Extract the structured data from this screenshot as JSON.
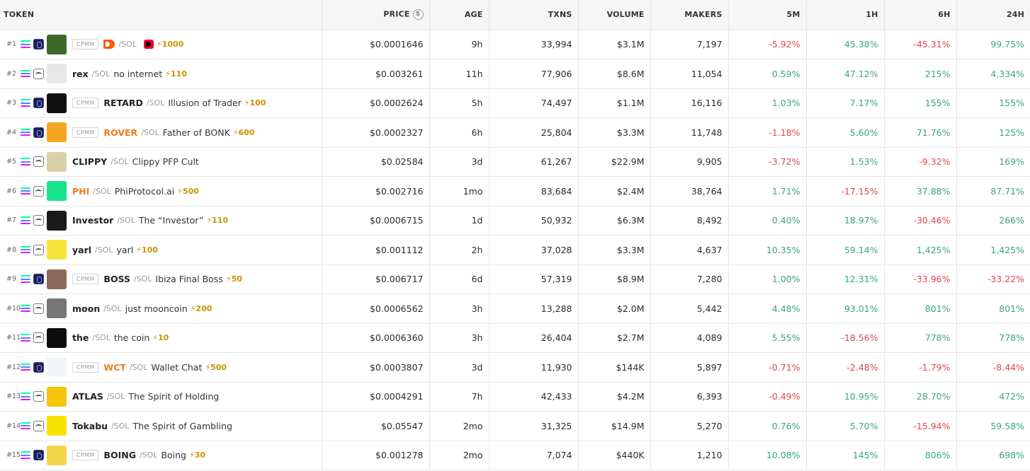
{
  "columns": {
    "token": "TOKEN",
    "price": "PRICE",
    "age": "AGE",
    "txns": "TXNS",
    "volume": "VOLUME",
    "makers": "MAKERS",
    "m5": "5M",
    "h1": "1H",
    "h6": "6H",
    "h24": "24H"
  },
  "rows": [
    {
      "rank": "#1",
      "cpmm": "CPMM",
      "symbol": "",
      "pair": "/SOL",
      "name": "",
      "boost": "⚡1000",
      "price": "$0.0001646",
      "age": "9h",
      "txns": "33,994",
      "volume": "$3.1M",
      "makers": "7,197",
      "m5": "-5.92%",
      "h1": "45.38%",
      "h6": "-45.31%",
      "h24": "99.75%",
      "dex": "a",
      "avatar": "#3a6b2a",
      "symbol_logo": true
    },
    {
      "rank": "#2",
      "cpmm": "",
      "symbol": "rex",
      "pair": "/SOL",
      "name": "no internet",
      "boost": "⚡110",
      "price": "$0.003261",
      "age": "11h",
      "txns": "77,906",
      "volume": "$8.6M",
      "makers": "11,054",
      "m5": "0.59%",
      "h1": "47.12%",
      "h6": "215%",
      "h24": "4,334%",
      "dex": "b",
      "avatar": "#e8e8e8"
    },
    {
      "rank": "#3",
      "cpmm": "CPMM",
      "symbol": "RETARD",
      "pair": "/SOL",
      "name": "Illusion of Trader",
      "boost": "⚡100",
      "price": "$0.0002624",
      "age": "5h",
      "txns": "74,497",
      "volume": "$1.1M",
      "makers": "16,116",
      "m5": "1.03%",
      "h1": "7.17%",
      "h6": "155%",
      "h24": "155%",
      "dex": "a",
      "avatar": "#111111"
    },
    {
      "rank": "#4",
      "cpmm": "CPMM",
      "symbol": "ROVER",
      "pair": "/SOL",
      "name": "Father of BONK",
      "boost": "⚡600",
      "price": "$0.0002327",
      "age": "6h",
      "txns": "25,804",
      "volume": "$3.3M",
      "makers": "11,748",
      "m5": "-1.18%",
      "h1": "5.60%",
      "h6": "71.76%",
      "h24": "125%",
      "dex": "a",
      "avatar": "#f2a81e",
      "orange": true
    },
    {
      "rank": "#5",
      "cpmm": "",
      "symbol": "CLIPPY",
      "pair": "/SOL",
      "name": "Clippy PFP Cult",
      "boost": "",
      "price": "$0.02584",
      "age": "3d",
      "txns": "61,267",
      "volume": "$22.9M",
      "makers": "9,905",
      "m5": "-3.72%",
      "h1": "1.53%",
      "h6": "-9.32%",
      "h24": "169%",
      "dex": "b",
      "avatar": "#d9d2a8"
    },
    {
      "rank": "#6",
      "cpmm": "",
      "symbol": "PHI",
      "pair": "/SOL",
      "name": "PhiProtocol.ai",
      "boost": "⚡500",
      "price": "$0.002716",
      "age": "1mo",
      "txns": "83,684",
      "volume": "$2.4M",
      "makers": "38,764",
      "m5": "1.71%",
      "h1": "-17.15%",
      "h6": "37.88%",
      "h24": "87.71%",
      "dex": "b",
      "avatar": "#18e28c",
      "orange": true
    },
    {
      "rank": "#7",
      "cpmm": "",
      "symbol": "Investor",
      "pair": "/SOL",
      "name": "The “Investor”",
      "boost": "⚡110",
      "price": "$0.0006715",
      "age": "1d",
      "txns": "50,932",
      "volume": "$6.3M",
      "makers": "8,492",
      "m5": "0.40%",
      "h1": "18.97%",
      "h6": "-30.46%",
      "h24": "266%",
      "dex": "b",
      "avatar": "#1a1a1a"
    },
    {
      "rank": "#8",
      "cpmm": "",
      "symbol": "yarl",
      "pair": "/SOL",
      "name": "yarl",
      "boost": "⚡100",
      "price": "$0.001112",
      "age": "2h",
      "txns": "37,028",
      "volume": "$3.3M",
      "makers": "4,637",
      "m5": "10.35%",
      "h1": "59.14%",
      "h6": "1,425%",
      "h24": "1,425%",
      "dex": "b",
      "avatar": "#f7e43a"
    },
    {
      "rank": "#9",
      "cpmm": "CPMM",
      "symbol": "BOSS",
      "pair": "/SOL",
      "name": "Ibiza Final Boss",
      "boost": "⚡50",
      "price": "$0.006717",
      "age": "6d",
      "txns": "57,319",
      "volume": "$8.9M",
      "makers": "7,280",
      "m5": "1.00%",
      "h1": "12.31%",
      "h6": "-33.96%",
      "h24": "-33.22%",
      "dex": "a",
      "avatar": "#8a6a5a"
    },
    {
      "rank": "#10",
      "cpmm": "",
      "symbol": "moon",
      "pair": "/SOL",
      "name": "just mooncoin",
      "boost": "⚡200",
      "price": "$0.0006562",
      "age": "3h",
      "txns": "13,288",
      "volume": "$2.0M",
      "makers": "5,442",
      "m5": "4.48%",
      "h1": "93.01%",
      "h6": "801%",
      "h24": "801%",
      "dex": "b",
      "avatar": "#777777"
    },
    {
      "rank": "#11",
      "cpmm": "",
      "symbol": "the",
      "pair": "/SOL",
      "name": "the coin",
      "boost": "⚡10",
      "price": "$0.0006360",
      "age": "3h",
      "txns": "26,404",
      "volume": "$2.7M",
      "makers": "4,089",
      "m5": "5.55%",
      "h1": "-18.56%",
      "h6": "778%",
      "h24": "778%",
      "dex": "b",
      "avatar": "#0c0c0c"
    },
    {
      "rank": "#12",
      "cpmm": "CPMM",
      "symbol": "WCT",
      "pair": "/SOL",
      "name": "Wallet Chat",
      "boost": "⚡500",
      "price": "$0.0003807",
      "age": "3d",
      "txns": "11,930",
      "volume": "$144K",
      "makers": "5,897",
      "m5": "-0.71%",
      "h1": "-2.48%",
      "h6": "-1.79%",
      "h24": "-8.44%",
      "dex": "a",
      "avatar": "#f1f4f8",
      "orange": true
    },
    {
      "rank": "#13",
      "cpmm": "",
      "symbol": "ATLAS",
      "pair": "/SOL",
      "name": "The Spirit of Holding",
      "boost": "",
      "price": "$0.0004291",
      "age": "7h",
      "txns": "42,433",
      "volume": "$4.2M",
      "makers": "6,393",
      "m5": "-0.49%",
      "h1": "10.95%",
      "h6": "28.70%",
      "h24": "472%",
      "dex": "b",
      "avatar": "#f5c40c"
    },
    {
      "rank": "#14",
      "cpmm": "",
      "symbol": "Tokabu",
      "pair": "/SOL",
      "name": "The Spirit of Gambling",
      "boost": "",
      "price": "$0.05547",
      "age": "2mo",
      "txns": "31,325",
      "volume": "$14.9M",
      "makers": "5,270",
      "m5": "0.76%",
      "h1": "5.70%",
      "h6": "-15.94%",
      "h24": "59.58%",
      "dex": "b",
      "avatar": "#f7e200"
    },
    {
      "rank": "#15",
      "cpmm": "CPMM",
      "symbol": "BOING",
      "pair": "/SOL",
      "name": "Boing",
      "boost": "⚡30",
      "price": "$0.001278",
      "age": "2mo",
      "txns": "7,074",
      "volume": "$440K",
      "makers": "1,210",
      "m5": "10.08%",
      "h1": "145%",
      "h6": "806%",
      "h24": "698%",
      "dex": "a",
      "avatar": "#f4d64a"
    }
  ]
}
